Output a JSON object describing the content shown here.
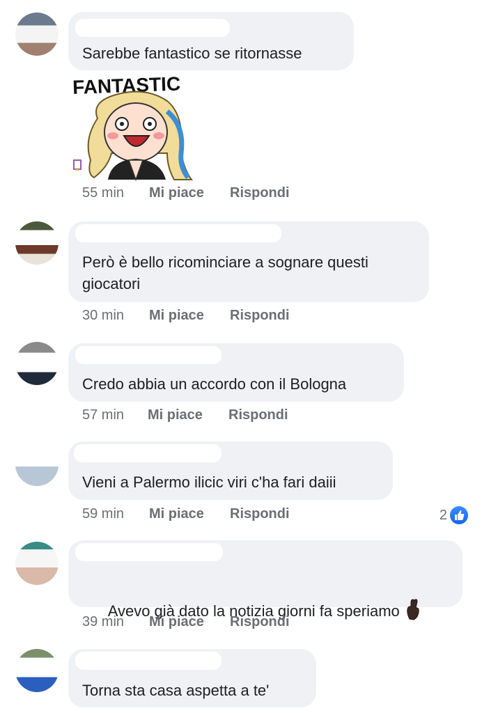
{
  "comments": [
    {
      "text": "Sarebbe fantastico se ritornasse",
      "time": "55 min",
      "like_label": "Mi piace",
      "reply_label": "Rispondi",
      "sticker": {
        "caption": "FANTASTIC"
      }
    },
    {
      "text": "Però è bello ricominciare a sognare questi giocatori",
      "time": "30 min",
      "like_label": "Mi piace",
      "reply_label": "Rispondi"
    },
    {
      "text": "Credo abbia un accordo con il Bologna",
      "time": "57 min",
      "like_label": "Mi piace",
      "reply_label": "Rispondi"
    },
    {
      "text": "Vieni a Palermo ilicic viri c'ha fari daiii",
      "time": "59 min",
      "like_label": "Mi piace",
      "reply_label": "Rispondi",
      "reaction_count": "2"
    },
    {
      "text": "Avevo già dato la notizia giorni fa speriamo",
      "time": "39 min",
      "like_label": "Mi piace",
      "reply_label": "Rispondi",
      "emoji": "crossed-fingers"
    },
    {
      "text": "Torna sta casa aspetta a te'"
    }
  ],
  "colors": {
    "bubble": "#eff1f4",
    "meta_text": "#6b6e73",
    "like_blue": "#1877f2"
  }
}
